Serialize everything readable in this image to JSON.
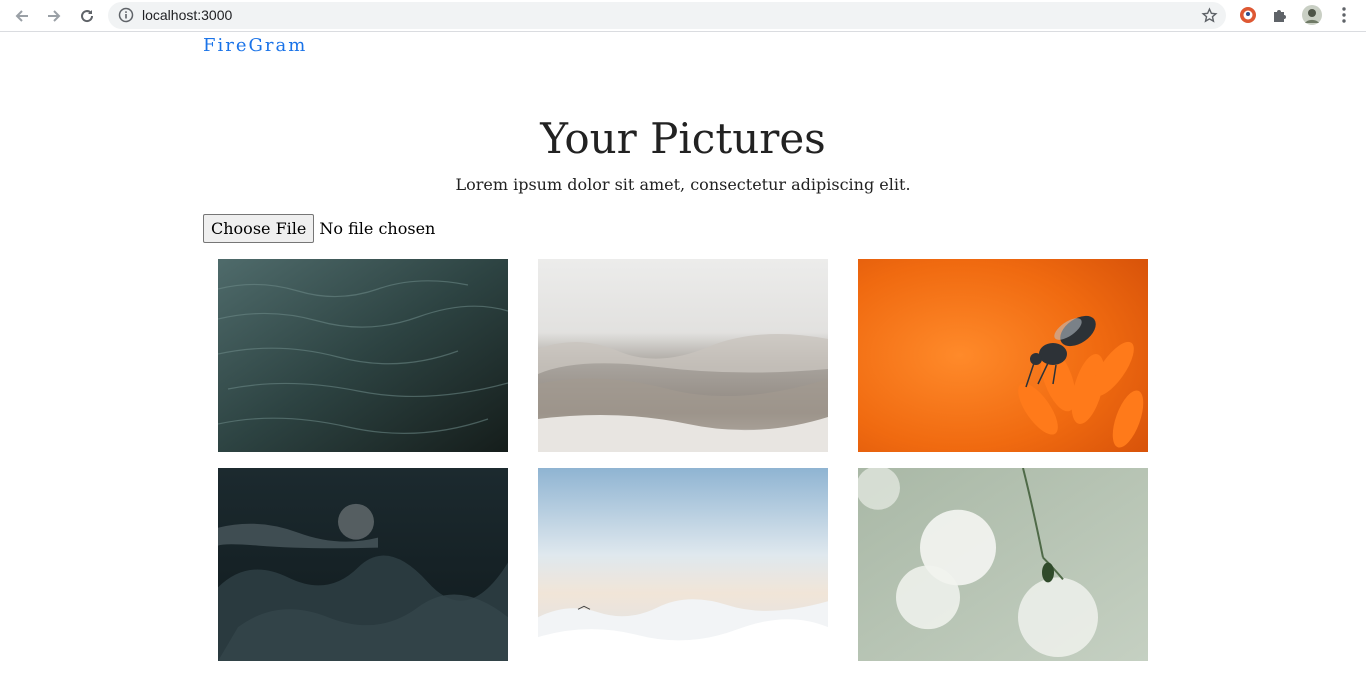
{
  "browser": {
    "url": "localhost:3000",
    "icons": [
      "back-arrow-icon",
      "forward-arrow-icon",
      "reload-icon",
      "site-info-icon",
      "bookmark-star-icon",
      "duckduckgo-extension-icon",
      "extensions-puzzle-icon",
      "profile-avatar-icon",
      "menu-kebab-icon"
    ]
  },
  "header": {
    "brand": "FireGram"
  },
  "main": {
    "title": "Your Pictures",
    "subtitle": "Lorem ipsum dolor sit amet, consectetur adipiscing elit.",
    "upload": {
      "button_label": "Choose File",
      "status": "No file chosen"
    },
    "gallery": [
      {
        "subject": "dark ocean water"
      },
      {
        "subject": "crashing waves"
      },
      {
        "subject": "bee on orange flower"
      },
      {
        "subject": "dark rocks"
      },
      {
        "subject": "clouds and sky"
      },
      {
        "subject": "white flowers"
      }
    ]
  },
  "colors": {
    "brand": "#1a73e8",
    "chrome_bg": "#f1f3f4"
  }
}
